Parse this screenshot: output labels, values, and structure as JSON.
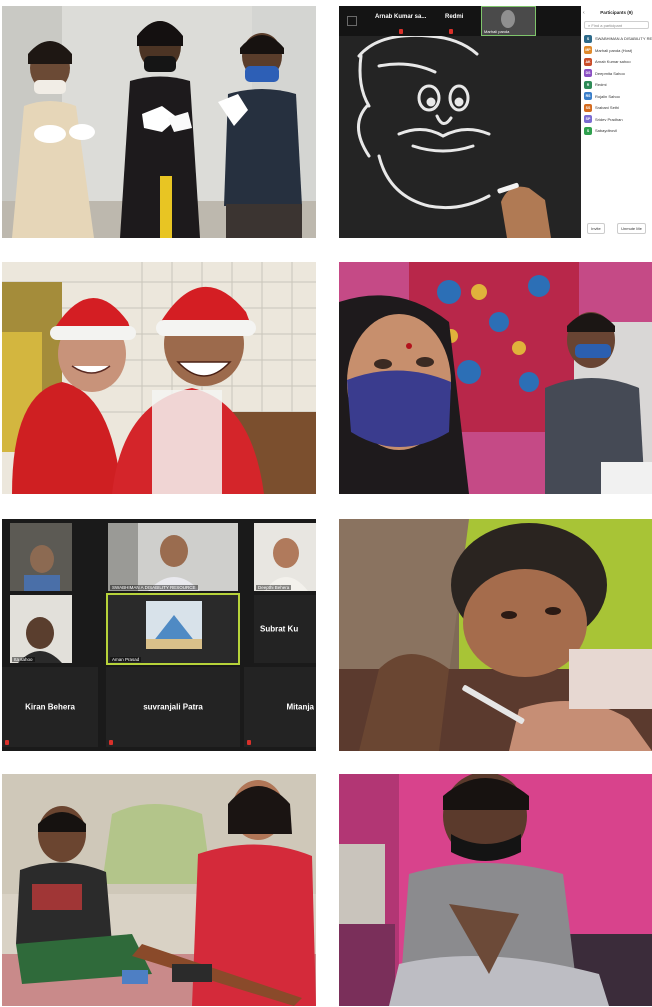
{
  "zoom_call": {
    "speaker_name": "Arnab Kumar sa...",
    "speaker_device": "Redmi",
    "thumbnail_name": "Marhali panda",
    "panel_title": "Participants (9)",
    "search_placeholder": "Find a participant",
    "participants": [
      {
        "initials": "S",
        "name": "SWABHIMAN A DISABILITY RESOURCE...",
        "color": "#2d6a8a"
      },
      {
        "initials": "MP",
        "name": "Marhali panda (Host)",
        "color": "#e08a2c"
      },
      {
        "initials": "AK",
        "name": "Arnab Kumar sahoo",
        "color": "#c94d2a"
      },
      {
        "initials": "DS",
        "name": "Deepmita Sahoo",
        "color": "#8a4fc2"
      },
      {
        "initials": "R",
        "name": "Redmi",
        "color": "#2e8b57"
      },
      {
        "initials": "RS",
        "name": "Rojalin Sahoo",
        "color": "#3a7ec9"
      },
      {
        "initials": "SS",
        "name": "Srabani Sethi",
        "color": "#d46b1f"
      },
      {
        "initials": "SP",
        "name": "Sridev Pradhan",
        "color": "#7a6bd1"
      },
      {
        "initials": "S",
        "name": "Sabaydtrovil",
        "color": "#2fa04e"
      }
    ],
    "invite_label": "Invite",
    "unmute_label": "Unmute Me"
  },
  "gallery_call": {
    "cells": [
      {
        "name": "",
        "big": ""
      },
      {
        "name": "SWABHIMAN A DISABILITY RESOURCE",
        "big": ""
      },
      {
        "name": "Deepthi Behera",
        "big": ""
      },
      {
        "name": "Ita sahoo",
        "big": ""
      },
      {
        "name": "Aman Prasad",
        "big": ""
      },
      {
        "name": "",
        "big": "Subrat Ku"
      },
      {
        "name": "",
        "big": "Kiran Behera"
      },
      {
        "name": "",
        "big": "suvranjali Patra"
      },
      {
        "name": "",
        "big": "Mitanja"
      }
    ]
  }
}
